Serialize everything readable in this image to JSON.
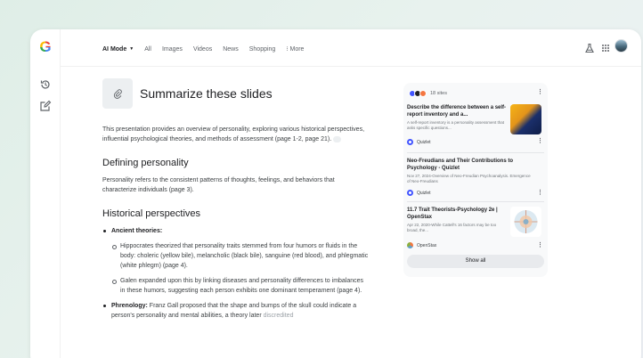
{
  "nav": {
    "mode": "AI Mode",
    "items": [
      "All",
      "Images",
      "Videos",
      "News",
      "Shopping"
    ],
    "more": "More"
  },
  "query": "Summarize these slides",
  "intro": "This presentation provides an overview of personality, exploring various historical perspectives, influential psychological theories, and methods of assessment (page 1-2, page 21).",
  "section1": {
    "heading": "Defining personality",
    "text": "Personality refers to the consistent patterns of thoughts, feelings, and behaviors that characterize individuals (page 3)."
  },
  "section2": {
    "heading": "Historical perspectives",
    "ancient_label": "Ancient theories:",
    "sub1": "Hippocrates theorized that personality traits stemmed from four humors or fluids in the body: choleric (yellow bile), melancholic (black bile), sanguine (red blood), and phlegmatic (white phlegm) (page 4).",
    "sub2": "Galen expanded upon this by linking diseases and personality differences to imbalances in these humors, suggesting each person exhibits one dominant temperament (page 4).",
    "phrenology_label": "Phrenology:",
    "phrenology_text": "Franz Gall proposed that the shape and bumps of the skull could indicate a person's personality and mental abilities, a theory later",
    "phrenology_fade": "discredited"
  },
  "sources": {
    "count": "18 sites",
    "cards": [
      {
        "title": "Describe the difference between a self-report inventory and a...",
        "snippet": "A self-report inventory is a personality assessment that asks specific questions...",
        "source": "Quizlet"
      },
      {
        "title": "Neo-Freudians and Their Contributions to Psychology - Quizlet",
        "snippet": "Nov 27, 2024-Overview of Neo-Freudian Psychoanalysis. Emergence of Neo-Freudians",
        "source": "Quizlet"
      },
      {
        "title": "11.7 Trait Theorists-Psychology 2e | OpenStax",
        "snippet": "Apr 22, 2020-While Cattell's 16 factors may be too broad, the...",
        "source": "OpenStax"
      }
    ],
    "show_all": "Show all"
  },
  "colors": {
    "accent_blue": "#4285f4",
    "quizlet": "#4255ff"
  }
}
